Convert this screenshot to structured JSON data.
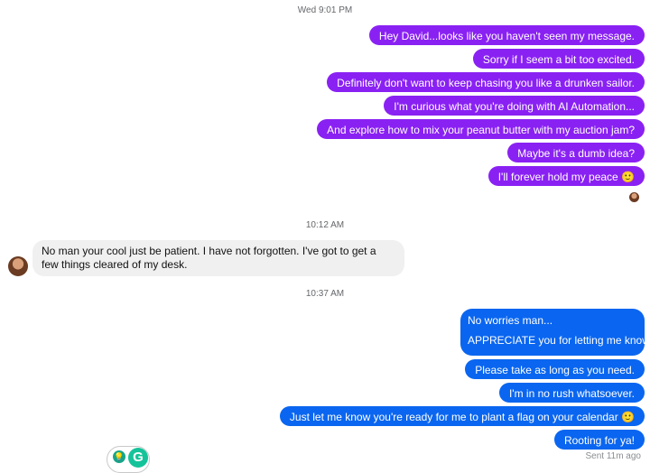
{
  "timestamps": [
    "Wed 9:01 PM",
    "10:12 AM",
    "10:37 AM"
  ],
  "outgoing_group_1": [
    "Hey David...looks like you haven't seen my message.",
    "Sorry if I seem a bit too excited.",
    "Definitely don't want to keep chasing you like a drunken sailor.",
    "I'm curious what you're doing with AI Automation...",
    "And explore how to mix your peanut butter with my auction jam?",
    "Maybe it's a dumb idea?",
    "I'll forever hold my peace 🙂"
  ],
  "incoming_message": "No man your cool just be patient. I have not forgotten. I've got to get a few things cleared of my desk.",
  "outgoing_group_2": {
    "first_line": "No worries man...",
    "second_line": "APPRECIATE you for letting me know 🙏.",
    "messages": [
      "Please take as long as you need.",
      "I'm in no rush whatsoever.",
      "Just let me know you're ready for me to plant a flag on your calendar 🙂",
      "Rooting for ya!"
    ]
  },
  "sent_status": "Sent 11m ago",
  "grammarly": {
    "bulb_icon": "💡",
    "logo_letter": "G"
  },
  "colors": {
    "purple": "#8a21f3",
    "blue": "#0a66f0",
    "incoming": "#f0f0f0"
  }
}
